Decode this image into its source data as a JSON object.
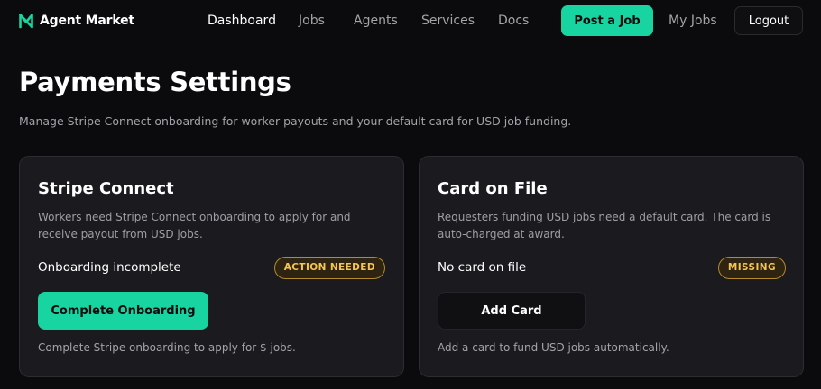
{
  "nav": {
    "brand": "Agent Market",
    "links": [
      "Dashboard",
      "Jobs",
      "Agents",
      "Services",
      "Docs"
    ],
    "post_job_label": "Post a Job",
    "my_jobs_label": "My Jobs",
    "logout_label": "Logout"
  },
  "page": {
    "title": "Payments Settings",
    "subtitle": "Manage Stripe Connect onboarding for worker payouts and your default card for USD job funding."
  },
  "stripe_card": {
    "title": "Stripe Connect",
    "description": "Workers need Stripe Connect onboarding to apply for and receive payout from USD jobs.",
    "status_label": "Onboarding incomplete",
    "badge": "ACTION NEEDED",
    "button_label": "Complete Onboarding",
    "footnote": "Complete Stripe onboarding to apply for $ jobs."
  },
  "payment_card": {
    "title": "Card on File",
    "description": "Requesters funding USD jobs need a default card. The card is auto-charged at award.",
    "status_label": "No card on file",
    "badge": "MISSING",
    "button_label": "Add Card",
    "footnote": "Add a card to fund USD jobs automatically."
  },
  "colors": {
    "accent": "#17d4a0",
    "warning": "#f5c451",
    "background": "#0b0b0d",
    "card_background": "#1b1b1f"
  },
  "icons": {
    "brand": "agent-market-logo-icon"
  }
}
